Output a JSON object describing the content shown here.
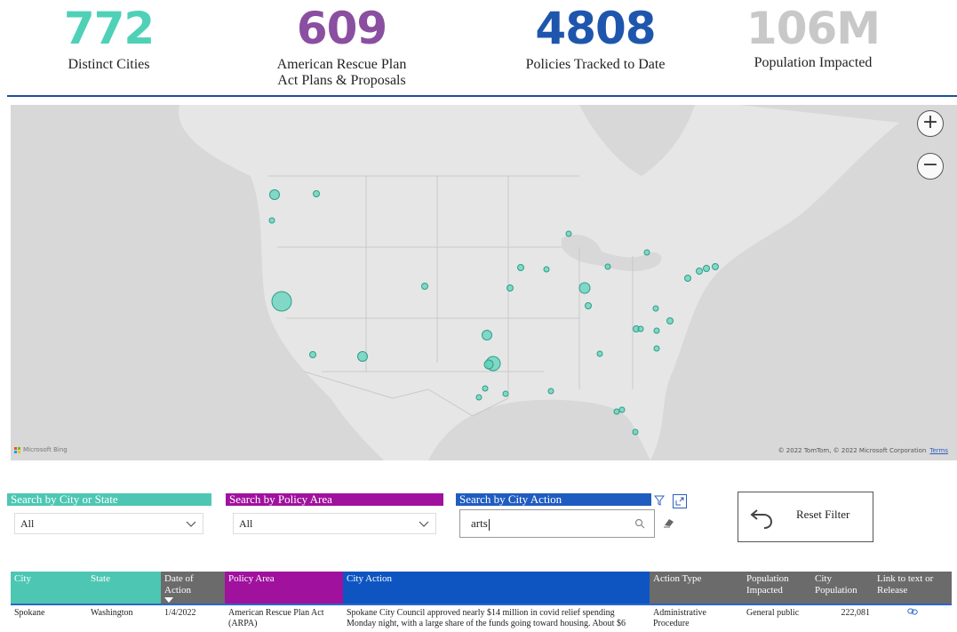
{
  "kpis": [
    {
      "value": "772",
      "label": "Distinct Cities",
      "color": "#4fd1b7"
    },
    {
      "value": "609",
      "label": "American Rescue Plan Act Plans & Proposals",
      "color": "#8a4fa0"
    },
    {
      "value": "4808",
      "label": "Policies Tracked to Date",
      "color": "#1f56ad"
    },
    {
      "value": "106M",
      "label": "Population Impacted",
      "color": "#c8c8c8"
    }
  ],
  "map": {
    "zoom_in": "+",
    "zoom_out": "−",
    "logo_text": "Microsoft Bing",
    "copyright": "© 2022 TomTom, © 2022 Microsoft Corporation",
    "terms": "Terms",
    "bubble_color": "#5fd3bb"
  },
  "slicers": {
    "city_state": {
      "label": "Search by City or State",
      "value": "All",
      "color": "#4dc7b3"
    },
    "policy_area": {
      "label": "Search by Policy Area",
      "value": "All",
      "color": "#a0119e"
    },
    "city_action": {
      "label": "Search by City Action",
      "value": "arts",
      "color": "#1f5cc0"
    }
  },
  "reset": {
    "label": "Reset Filter"
  },
  "table": {
    "columns": [
      {
        "label": "City",
        "color": "#4dc7b3"
      },
      {
        "label": "State",
        "color": "#4dc7b3"
      },
      {
        "label": "Date of Action",
        "color": "#6b6b6b"
      },
      {
        "label": "Policy Area",
        "color": "#a0119e"
      },
      {
        "label": "City Action",
        "color": "#0e55c2"
      },
      {
        "label": "Action Type",
        "color": "#6b6b6b"
      },
      {
        "label": "Population Impacted",
        "color": "#6b6b6b"
      },
      {
        "label": "City Population",
        "color": "#6b6b6b"
      },
      {
        "label": "Link to text or Release",
        "color": "#6b6b6b"
      }
    ],
    "rows": [
      {
        "city": "Spokane",
        "state": "Washington",
        "date": "1/4/2022",
        "policy_area": "American Rescue Plan Act (ARPA)",
        "action": "Spokane City Council approved nearly $14 million in covid relief spending Monday night, with a large share of the funds going toward housing. About $6",
        "action_type": "Administrative Procedure",
        "pop_impacted": "General public",
        "city_pop": "222,081",
        "link_icon": "link-icon"
      }
    ]
  }
}
